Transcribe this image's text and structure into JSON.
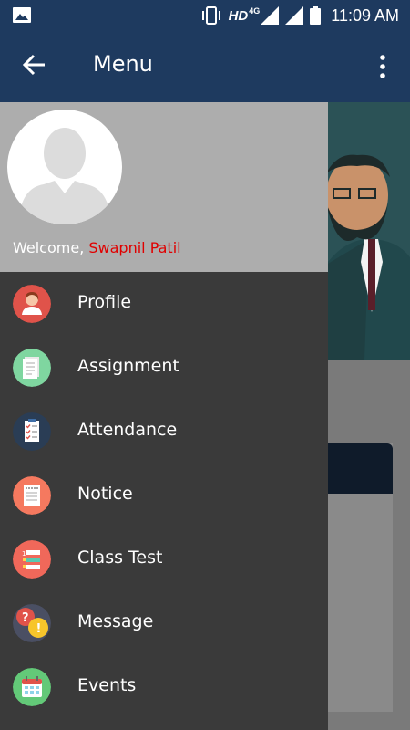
{
  "status_bar": {
    "hd": "HD",
    "network": "4G",
    "time": "11:09 AM"
  },
  "app_bar": {
    "title": "Menu",
    "back_icon": "arrow-left-icon",
    "more_icon": "more-vertical-icon"
  },
  "drawer": {
    "welcome_label": "Welcome,",
    "user_name": "Swapnil Patil",
    "items": [
      {
        "label": "Profile",
        "icon": "profile-icon",
        "color": "#e0534a"
      },
      {
        "label": "Assignment",
        "icon": "assignment-icon",
        "color": "#7fd6a0"
      },
      {
        "label": "Attendance",
        "icon": "attendance-icon",
        "color": "#2a3d55"
      },
      {
        "label": "Notice",
        "icon": "notice-icon",
        "color": "#f5795f"
      },
      {
        "label": "Class Test",
        "icon": "class-test-icon",
        "color": "#f0685a"
      },
      {
        "label": "Message",
        "icon": "message-icon",
        "color": "#4a4f63"
      },
      {
        "label": "Events",
        "icon": "events-icon",
        "color": "#63c978"
      }
    ]
  },
  "colors": {
    "app_bar": "#1e3a5f",
    "drawer_bg": "#3a3a3a",
    "header_bg": "#adadad",
    "name_accent": "#e00000"
  }
}
